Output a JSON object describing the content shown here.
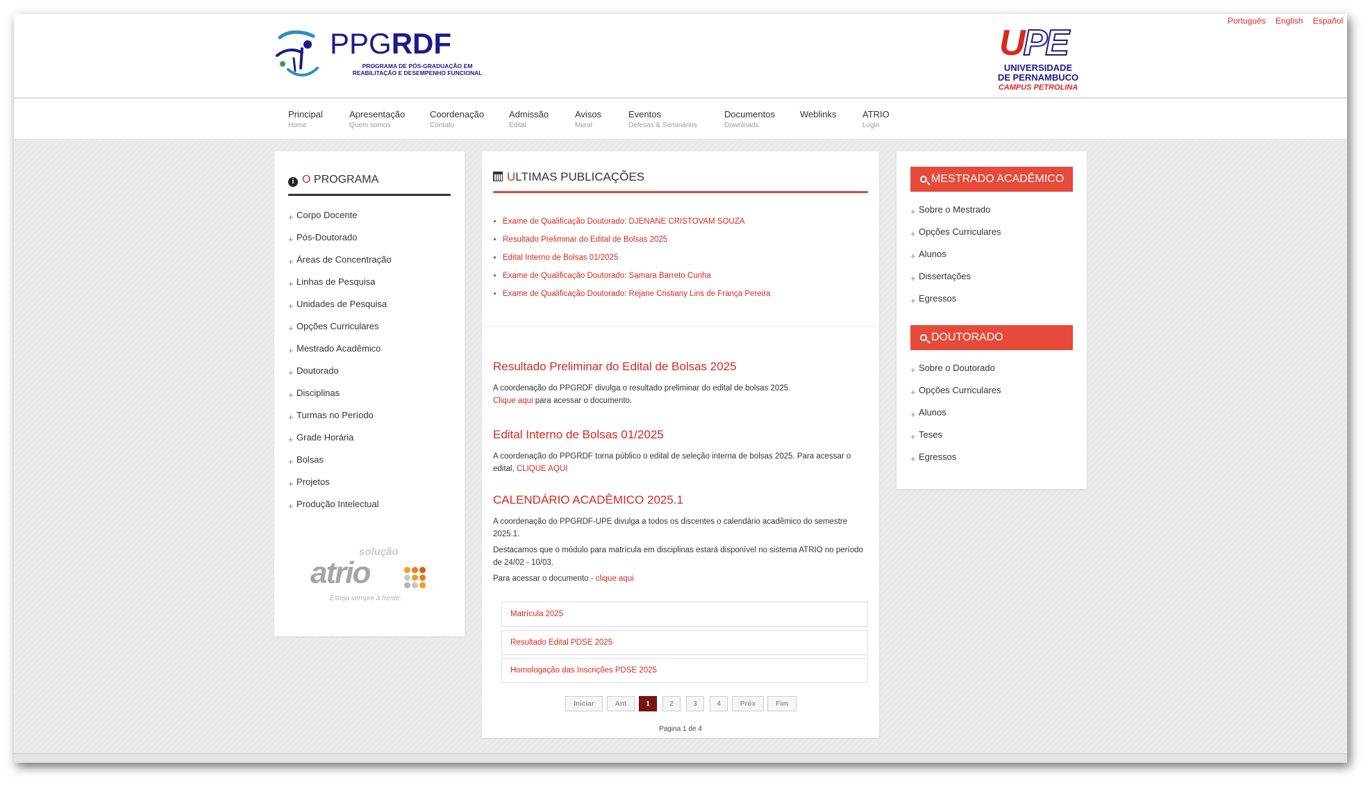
{
  "languages": [
    "Português",
    "English",
    "Español"
  ],
  "logo_left": {
    "title_bold": "PPG",
    "title_rest": "RDF",
    "subtitle_1": "PROGRAMA DE PÓS-GRADUAÇÃO EM",
    "subtitle_2": "REABILITAÇÃO E DESEMPENHO FUNCIONAL"
  },
  "logo_right": {
    "mark_u": "U",
    "mark_pe": "PE",
    "line1": "UNIVERSIDADE",
    "line2": "DE PERNAMBUCO",
    "line3": "CAMPUS PETROLINA"
  },
  "nav": [
    {
      "label": "Principal",
      "sub": "Home"
    },
    {
      "label": "Apresentação",
      "sub": "Quem somos"
    },
    {
      "label": "Coordenação",
      "sub": "Contato"
    },
    {
      "label": "Admissão",
      "sub": "Edital"
    },
    {
      "label": "Avisos",
      "sub": "Mural"
    },
    {
      "label": "Eventos",
      "sub": "Defesas & Seminários"
    },
    {
      "label": "Documentos",
      "sub": "Downloads"
    },
    {
      "label": "Weblinks",
      "sub": ""
    },
    {
      "label": "ATRIO",
      "sub": "Login"
    }
  ],
  "left_panel": {
    "title_first": "O",
    "title_rest": " PROGRAMA",
    "items": [
      "Corpo Docente",
      "Pós-Doutorado",
      "Áreas de Concentração",
      "Linhas de Pesquisa",
      "Unidades de Pesquisa",
      "Opções Curriculares",
      "Mestrado Acadêmico",
      "Doutorado",
      "Disciplinas",
      "Turmas no Período",
      "Grade Horária",
      "Bolsas",
      "Projetos",
      "Produção Intelectual"
    ],
    "atrio": {
      "top": "solução",
      "word": "atrio",
      "tagline": "Esteja sempre à frente."
    }
  },
  "center": {
    "title_first": "U",
    "title_rest": "LTIMAS PUBLICAÇÕES",
    "recent": [
      "Exame de Qualificação Doutorado: DJENANE CRISTOVAM SOUZA",
      "Resultado Preliminar do Edital de Bolsas 2025",
      "Edital Interno de Bolsas 01/2025",
      "Exame de Qualificação Doutorado: Samara Barreto Cunha",
      "Exame de Qualificação Doutorado: Rejane Cristiany Lins de França Pereira"
    ],
    "post1": {
      "title": "Resultado Preliminar do Edital de Bolsas 2025",
      "text": "A coordenação do PPGRDF divulga o resultado preliminar do edital de bolsas 2025.",
      "link": "Clique aqui",
      "after": " para acessar o documento."
    },
    "post2": {
      "title": "Edital Interno de Bolsas 01/2025",
      "text": "A coordenação do PPGRDF torna público o edital de seleção interna de bolsas 2025. Para acessar o edital, ",
      "link": "CLIQUE AQUI"
    },
    "post3": {
      "title": "CALENDÁRIO ACADÊMICO 2025.1",
      "text1": "A coordenação do PPGRDF-UPE divulga a todos os discentes o calendário acadêmico do semestre 2025.1.",
      "text2": "Destacamos que o módulo para matrícula em disciplinas estará disponível no sistema ATRIO no período de 24/02 - 10/03.",
      "text3": "Para acessar o documento - ",
      "link": "clique aqui"
    },
    "boxes": [
      "Matrícula 2025",
      "Resultado Edital PDSE 2025",
      "Homologação das Inscrições PDSE 2025"
    ],
    "pagination": {
      "first": "Iniciar",
      "prev": "Ant",
      "pages": [
        "1",
        "2",
        "3",
        "4"
      ],
      "next": "Próx",
      "last": "Fim",
      "status": "Pagina 1 de 4"
    }
  },
  "right_panel": {
    "mestrado_title": "MESTRADO ACADÊMICO",
    "mestrado_items": [
      "Sobre o Mestrado",
      "Opções Curriculares",
      "Alunos",
      "Dissertações",
      "Egressos"
    ],
    "doutorado_title": "DOUTORADO",
    "doutorado_items": [
      "Sobre o Doutorado",
      "Opções Curriculares",
      "Alunos",
      "Teses",
      "Egressos"
    ]
  },
  "colors": {
    "accent": "#d9281c",
    "header_red": "#e64a3b",
    "brand_blue": "#1d1a8a",
    "active_page": "#7c1212"
  }
}
